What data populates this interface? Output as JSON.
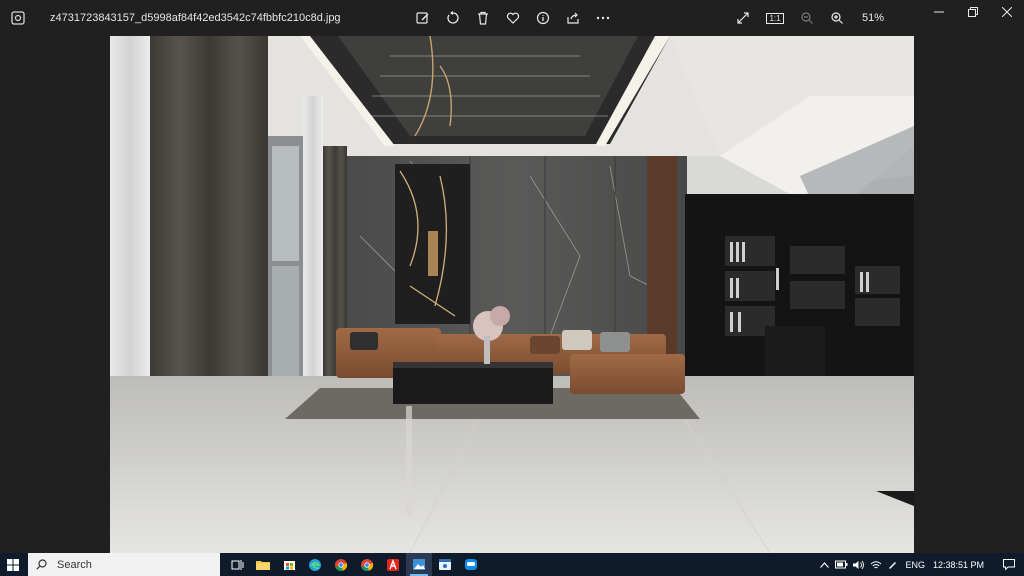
{
  "window": {
    "filename": "z4731723843157_d5998af84f42ed3542c74fbbfc210c8d.jpg",
    "zoom": "51%",
    "actual_size_label": "1:1"
  },
  "toolbar": {
    "icons": [
      "edit-image-icon",
      "rotate-icon",
      "delete-icon",
      "favorite-icon",
      "info-icon",
      "share-icon",
      "more-icon"
    ]
  },
  "taskbar": {
    "search_placeholder": "Search",
    "language": "ENG",
    "time": "12:38:51 PM"
  }
}
